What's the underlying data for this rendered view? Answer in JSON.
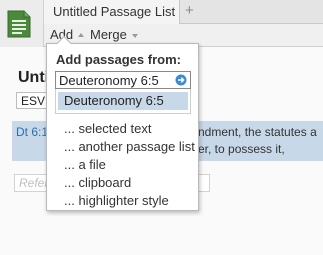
{
  "tabs": {
    "active_label": "Untitled Passage List",
    "add_symbol": "+"
  },
  "toolbar": {
    "add_label": "Add",
    "merge_label": "Merge"
  },
  "document": {
    "title_visible": "Untit",
    "version": "ESV",
    "passage_ref": "Dt 6:1",
    "passage_text_line1": "ndment, the statutes a",
    "passage_text_line2": "er, to possess it,",
    "reference_placeholder": "Refer"
  },
  "popup": {
    "heading": "Add passages from:",
    "input_value": "Deuteronomy 6:5",
    "suggestion": "Deuteronomy 6:5",
    "items": [
      "... selected text",
      "... another passage list",
      "... a file",
      "... clipboard",
      "... highlighter style"
    ]
  },
  "colors": {
    "selection": "#c7d8e8",
    "accent": "#3a8bd6",
    "app_icon": "#4a8a3a"
  },
  "icons": {
    "app": "passage-list-icon",
    "go": "go-arrow-icon"
  }
}
